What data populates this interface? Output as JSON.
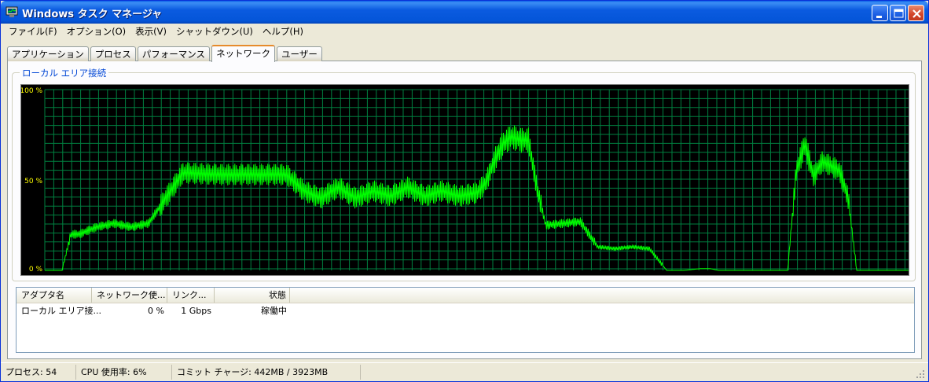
{
  "window": {
    "title": "Windows タスク マネージャ"
  },
  "menu": {
    "items": [
      "ファイル(F)",
      "オプション(O)",
      "表示(V)",
      "シャットダウン(U)",
      "ヘルプ(H)"
    ]
  },
  "tabs": {
    "items": [
      "アプリケーション",
      "プロセス",
      "パフォーマンス",
      "ネットワーク",
      "ユーザー"
    ],
    "active": "ネットワーク"
  },
  "network": {
    "group_label": "ローカル エリア接続",
    "y_labels": [
      "100 %",
      "50 %",
      "0 %"
    ]
  },
  "list": {
    "columns": [
      "アダプタ名",
      "ネットワーク使...",
      "リンク...",
      "状態"
    ],
    "rows": [
      [
        "ローカル エリア接...",
        "0 %",
        "1 Gbps",
        "稼働中"
      ]
    ]
  },
  "status": {
    "processes": "プロセス: 54",
    "cpu": "CPU 使用率: 6%",
    "commit": "コミット チャージ: 442MB / 3923MB"
  },
  "colors": {
    "graph_bg": "#000000",
    "grid": "#008040",
    "line": "#00ff00",
    "accent_tab": "#e68b2c",
    "group_label": "#0046d5"
  },
  "chart_data": {
    "type": "line",
    "title": "",
    "ylim": [
      0,
      100
    ],
    "y_ticks": [
      "0 %",
      "50 %",
      "100 %"
    ],
    "grid": true,
    "x": [
      0,
      2,
      3,
      4,
      6,
      8,
      10,
      12,
      16,
      20,
      28,
      30,
      32,
      34,
      36,
      38,
      40,
      42,
      44,
      46,
      48,
      50,
      51,
      52,
      53,
      54,
      55,
      56,
      57,
      58,
      60,
      62,
      64,
      66,
      68,
      70,
      72,
      74,
      76,
      77,
      78,
      79,
      80,
      82,
      84,
      86,
      87,
      88,
      89,
      90,
      91,
      92,
      93,
      94,
      95,
      96,
      97,
      98,
      99,
      100
    ],
    "series": [
      {
        "values": [
          0,
          0,
          20,
          20,
          24,
          26,
          24,
          26,
          54,
          53,
          53,
          44,
          40,
          46,
          40,
          44,
          41,
          46,
          41,
          44,
          41,
          43,
          48,
          60,
          70,
          74,
          72,
          72,
          45,
          25,
          26,
          27,
          13,
          12,
          13,
          12,
          0,
          0,
          1,
          1,
          0,
          0,
          0,
          0,
          0,
          0,
          55,
          70,
          52,
          60,
          58,
          55,
          40,
          0,
          0,
          0,
          0,
          0,
          0,
          0
        ]
      }
    ]
  }
}
